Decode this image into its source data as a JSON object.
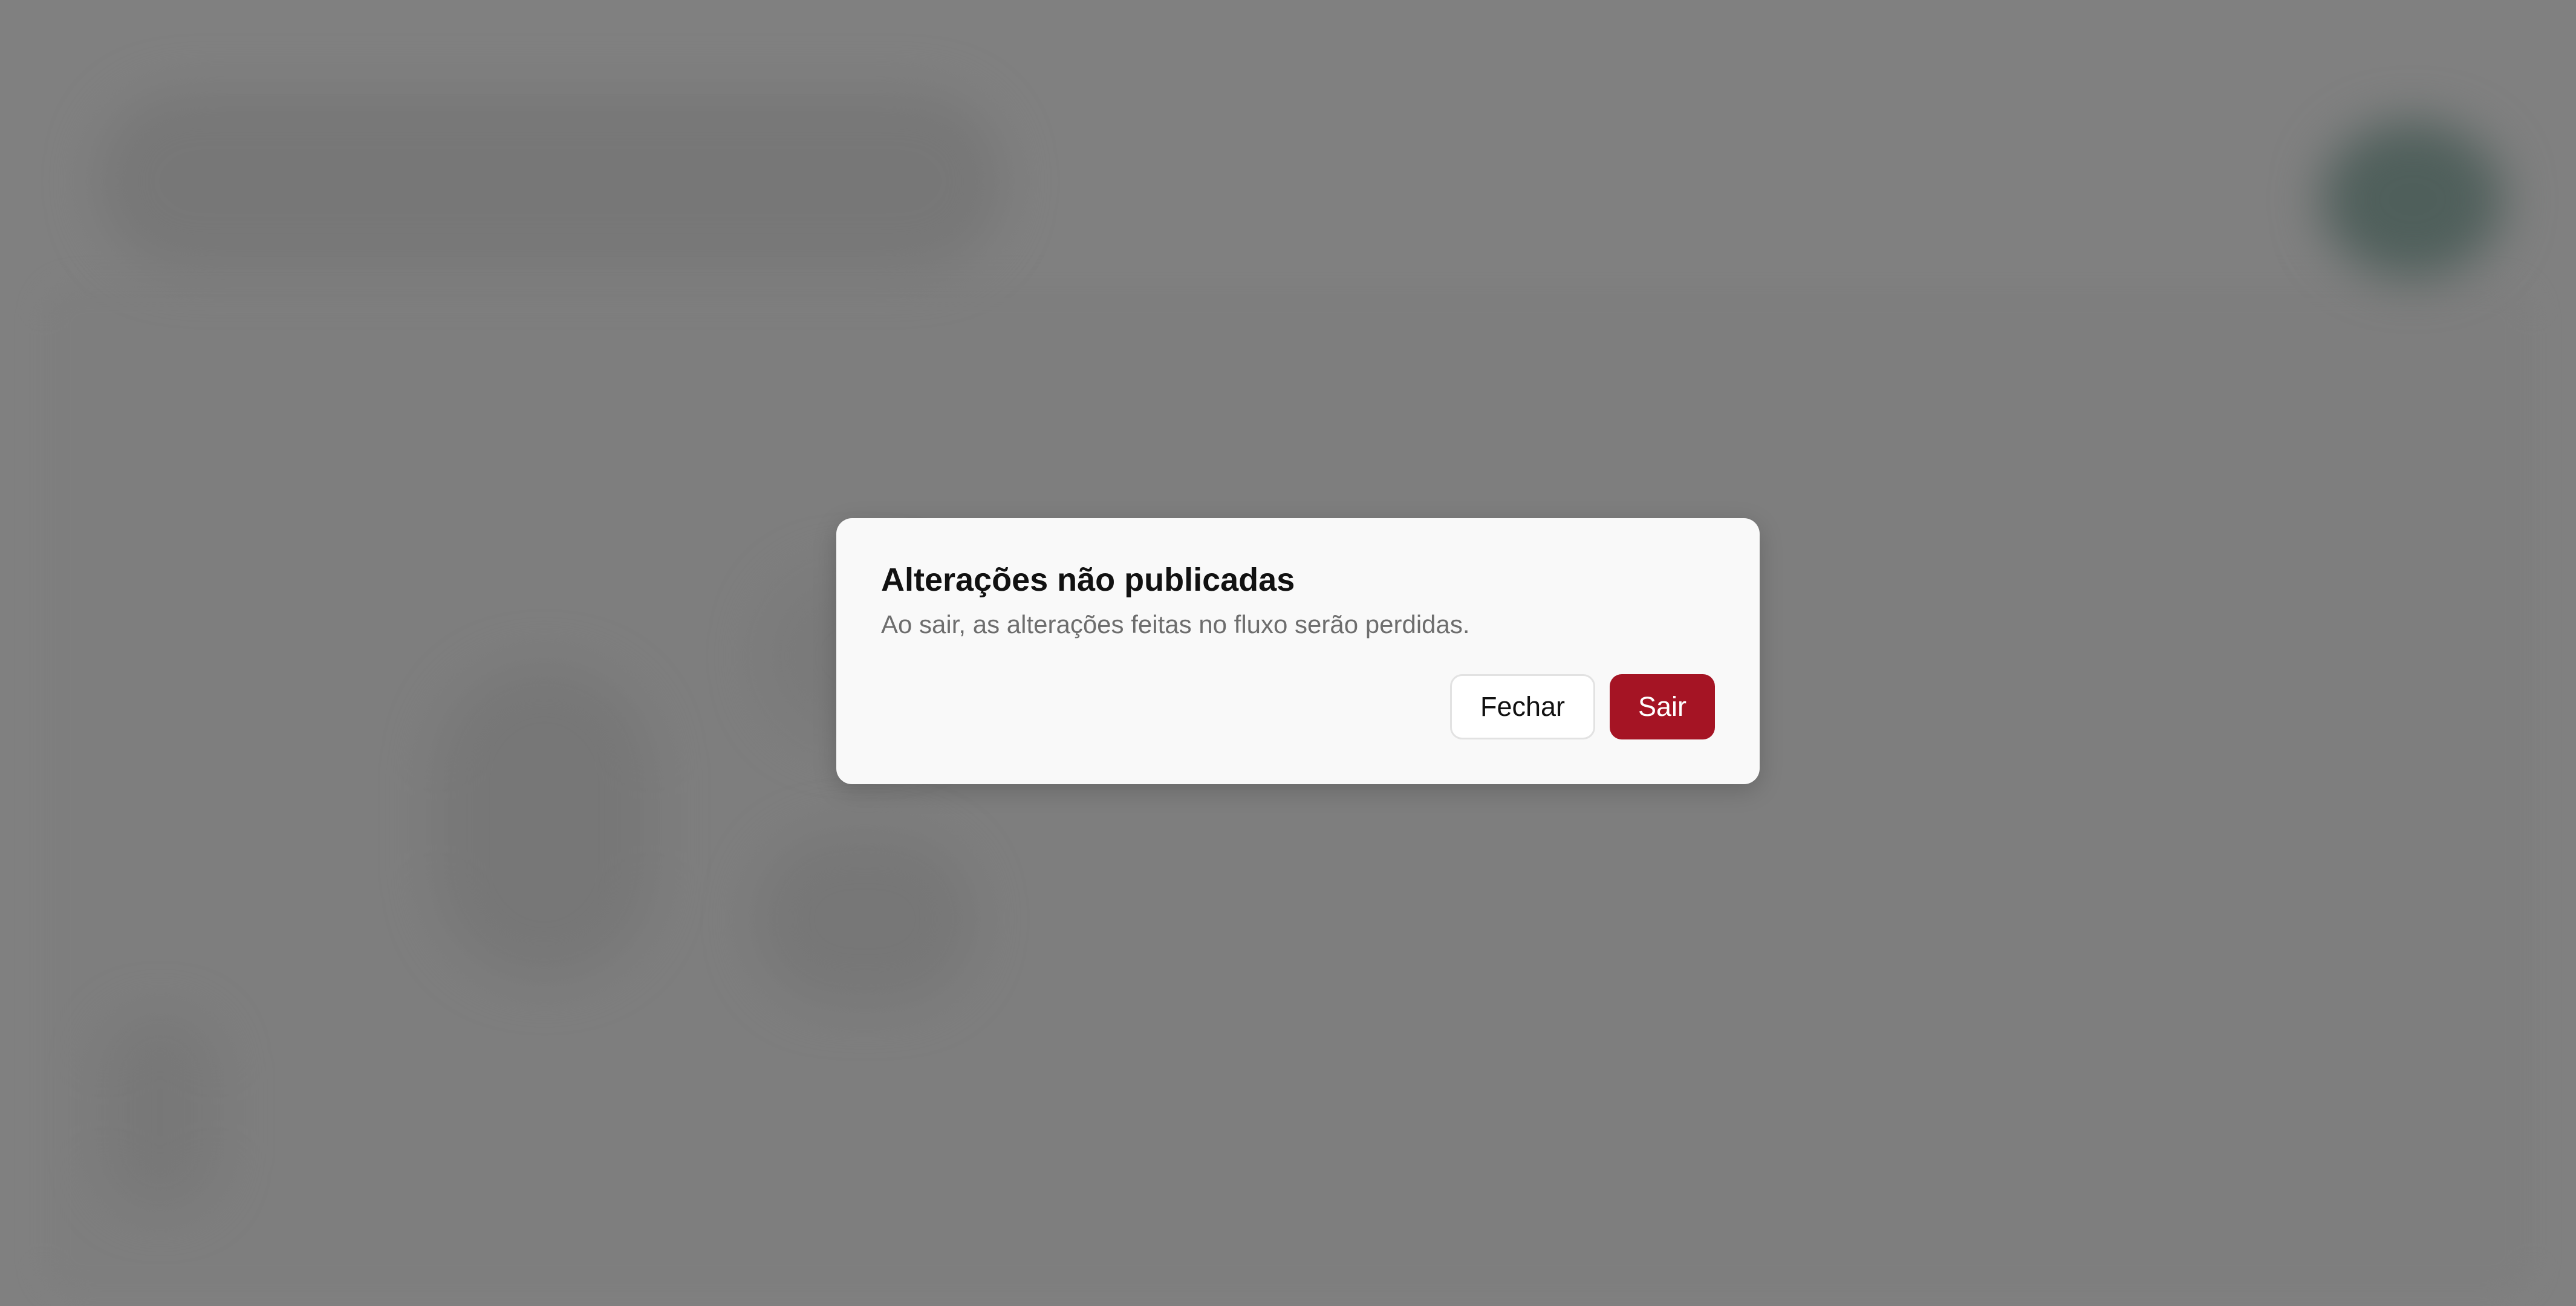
{
  "dialog": {
    "title": "Alterações não publicadas",
    "description": "Ao sair, as alterações feitas no fluxo serão perdidas.",
    "close_label": "Fechar",
    "exit_label": "Sair"
  },
  "colors": {
    "overlay": "#808080",
    "dialog_background": "#f9f9f9",
    "danger": "#a51424",
    "title_text": "#111111",
    "description_text": "#6d6d6d"
  }
}
